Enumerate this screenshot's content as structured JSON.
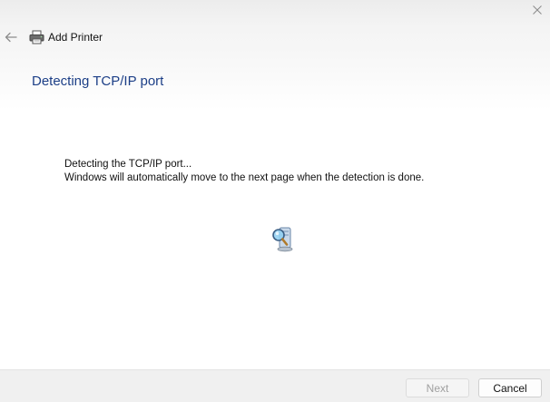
{
  "window": {
    "title": "Add Printer",
    "close_icon": "close-icon",
    "back_icon": "arrow-left-icon",
    "title_icon": "printer-icon"
  },
  "page": {
    "heading": "Detecting TCP/IP port",
    "message_line1": "Detecting the TCP/IP port...",
    "message_line2": "Windows will automatically move to the next page when the detection is done.",
    "progress_icon": "computer-search-icon"
  },
  "footer": {
    "next_label": "Next",
    "next_enabled": false,
    "cancel_label": "Cancel"
  },
  "colors": {
    "heading": "#1c3f87",
    "disabled_text": "#a0a0a0"
  }
}
